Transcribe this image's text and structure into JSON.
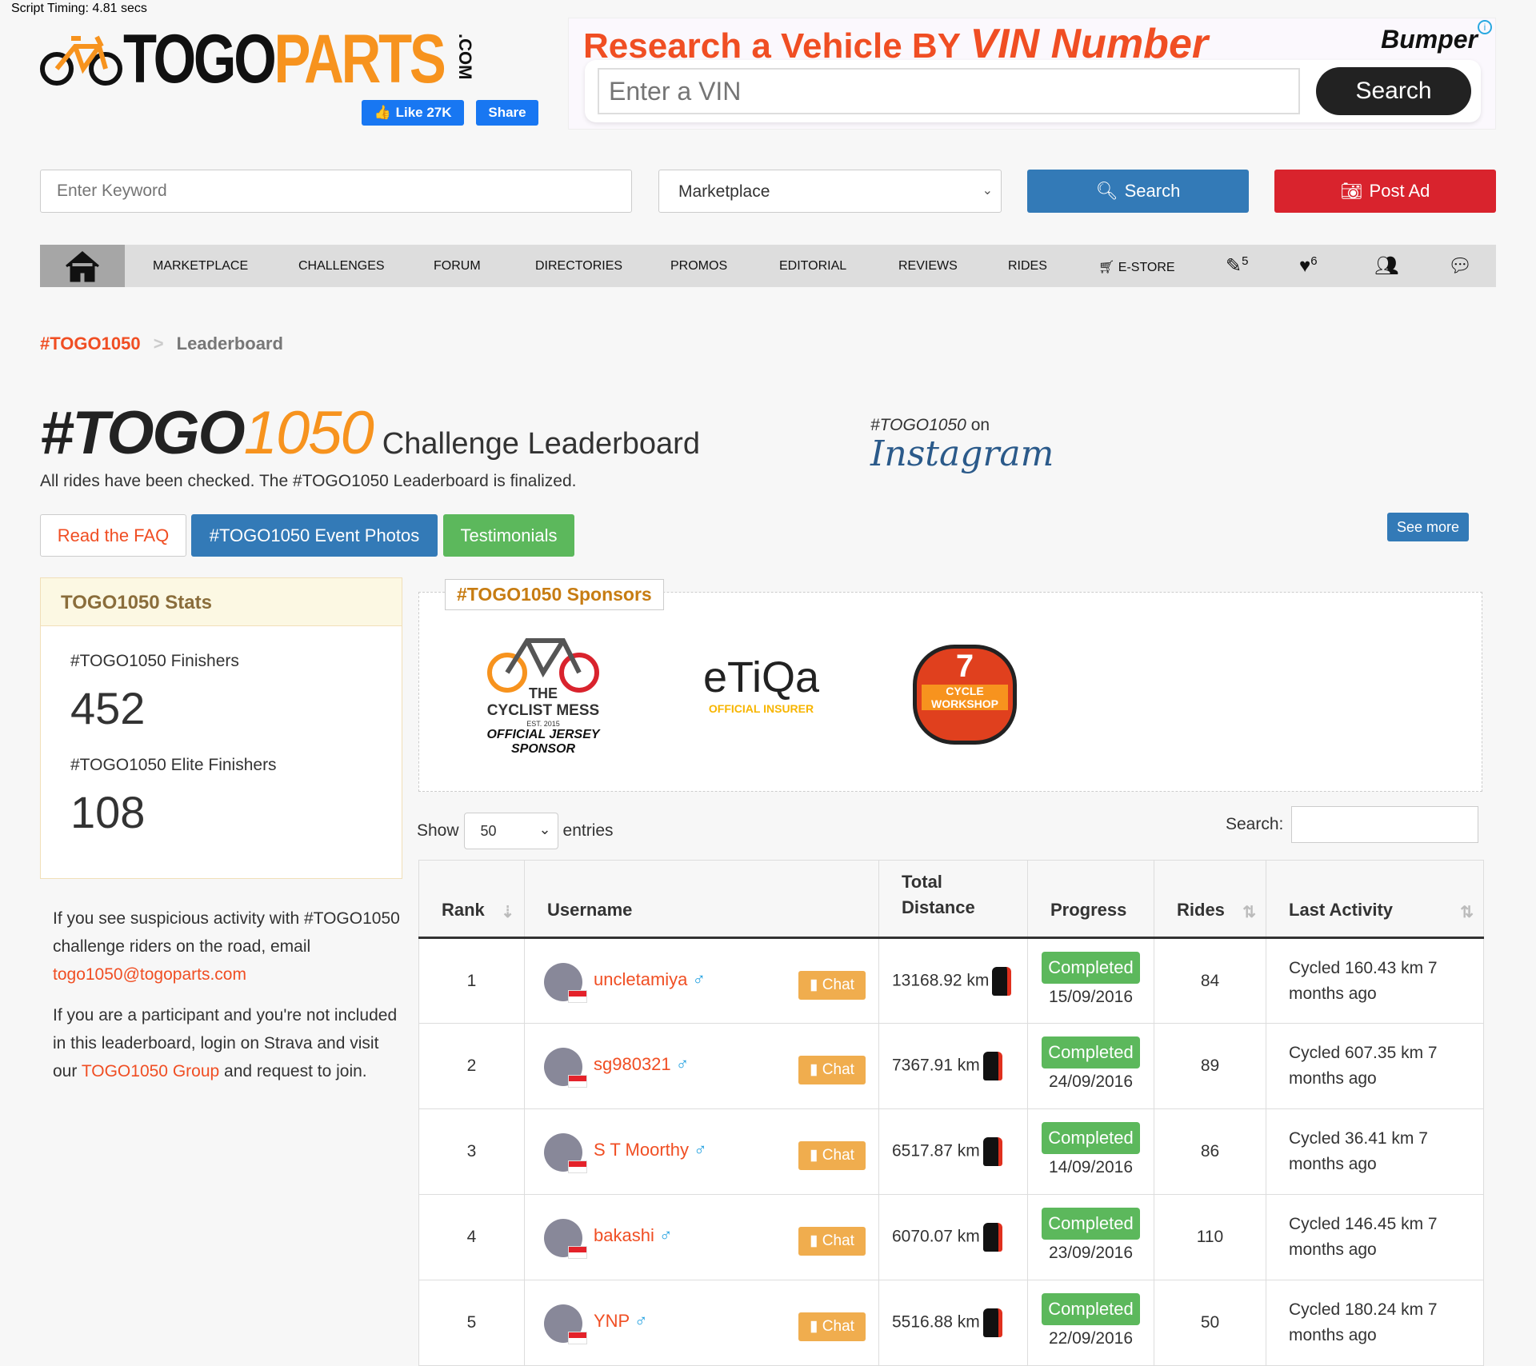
{
  "script_timing": "Script Timing: 4.81 secs",
  "logo": {
    "part1": "TOGO",
    "part2": "PARTS",
    "suffix": ".COM"
  },
  "social": {
    "like": "Like 27K",
    "share": "Share"
  },
  "ad": {
    "headline": "Research a Vehicle BY",
    "headline_em": "VIN Number",
    "brand": "Bumper",
    "vin_placeholder": "Enter a VIN",
    "search": "Search",
    "info": "i"
  },
  "search": {
    "keyword_placeholder": "Enter Keyword",
    "category": "Marketplace",
    "search": "Search",
    "post_ad": "Post Ad"
  },
  "nav": {
    "items": [
      "Marketplace",
      "Challenges",
      "Forum",
      "Directories",
      "Promos",
      "Editorial",
      "Reviews",
      "Rides",
      "E-Store"
    ],
    "edit_count": "5",
    "fav_count": "6"
  },
  "breadcrumb": {
    "root": "#TOGO1050",
    "sep": ">",
    "current": "Leaderboard"
  },
  "title": {
    "prefix": "#TOGO",
    "num": "1050",
    "rest": "Challenge Leaderboard",
    "subtitle": "All rides have been checked. The #TOGO1050 Leaderboard is finalized."
  },
  "instagram": {
    "tag": "#TOGO1050",
    "on": " on",
    "name": "Instagram",
    "see_more": "See more"
  },
  "buttons": {
    "faq": "Read the FAQ",
    "photos": "#TOGO1050 Event Photos",
    "testimonials": "Testimonials"
  },
  "stats": {
    "title": "TOGO1050 Stats",
    "finishers_label": "#TOGO1050 Finishers",
    "finishers": "452",
    "elite_label": "#TOGO1050 Elite Finishers",
    "elite": "108"
  },
  "note": {
    "p1a": "If you see suspicious activity with #TOGO1050 challenge riders on the road, email ",
    "email": "togo1050@togoparts.com",
    "p2a": "If you are a participant and you're not included in this leaderboard, login on Strava and visit our ",
    "group": "TOGO1050 Group",
    "p2b": " and request to join."
  },
  "sponsors": {
    "title": "#TOGO1050 Sponsors",
    "s1a": "THE",
    "s1b": "CYCLIST MESS",
    "s1c": "EST. 2015",
    "s1d": "OFFICIAL JERSEY SPONSOR",
    "s2a": "eTiQa",
    "s2b": "OFFICIAL INSURER",
    "s3a": "7",
    "s3b": "CYCLE WORKSHOP"
  },
  "table_controls": {
    "show": "Show",
    "entries_value": "50",
    "entries": "entries",
    "search": "Search:"
  },
  "table": {
    "headers": [
      "Rank",
      "Username",
      "Total Distance",
      "Progress",
      "Rides",
      "Last Activity"
    ],
    "chat": "Chat",
    "gender": "♂",
    "rows": [
      {
        "rank": "1",
        "user": "uncletamiya",
        "distance": "13168.92 km",
        "status": "Completed",
        "date": "15/09/2016",
        "rides": "84",
        "activity": "Cycled 160.43 km 7 months ago"
      },
      {
        "rank": "2",
        "user": "sg980321",
        "distance": "7367.91 km",
        "status": "Completed",
        "date": "24/09/2016",
        "rides": "89",
        "activity": "Cycled 607.35 km 7 months ago"
      },
      {
        "rank": "3",
        "user": "S T Moorthy",
        "distance": "6517.87 km",
        "status": "Completed",
        "date": "14/09/2016",
        "rides": "86",
        "activity": "Cycled 36.41 km 7 months ago"
      },
      {
        "rank": "4",
        "user": "bakashi",
        "distance": "6070.07 km",
        "status": "Completed",
        "date": "23/09/2016",
        "rides": "110",
        "activity": "Cycled 146.45 km 7 months ago"
      },
      {
        "rank": "5",
        "user": "YNP",
        "distance": "5516.88 km",
        "status": "Completed",
        "date": "22/09/2016",
        "rides": "50",
        "activity": "Cycled 180.24 km 7 months ago"
      }
    ]
  }
}
